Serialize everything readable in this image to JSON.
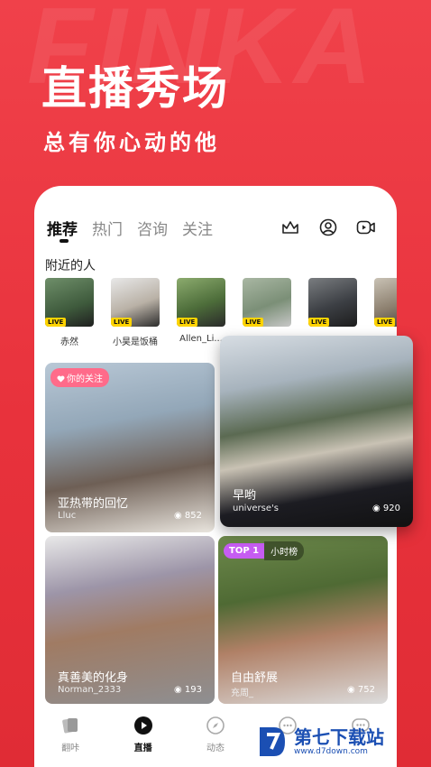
{
  "hero": {
    "bg_logo": "FINKA",
    "title": "直播秀场",
    "subtitle": "总有你心动的他"
  },
  "tabs": [
    {
      "label": "推荐",
      "active": true
    },
    {
      "label": "热门",
      "active": false
    },
    {
      "label": "咨询",
      "active": false
    },
    {
      "label": "关注",
      "active": false
    }
  ],
  "top_icons": [
    "crown-icon",
    "profile-circle-icon",
    "live-camera-icon"
  ],
  "nearby": {
    "label": "附近的人",
    "live_badge": "LIVE",
    "people": [
      {
        "name": "赤然"
      },
      {
        "name": "小昊是饭桶"
      },
      {
        "name": "Allen_Li..."
      },
      {
        "name": ""
      },
      {
        "name": ""
      },
      {
        "name": ""
      }
    ]
  },
  "cards": [
    {
      "title": "亚热带的回忆",
      "user": "Lluc",
      "views": "852",
      "badge": "你的关注"
    },
    {
      "title": "早哟",
      "user": "universe's",
      "views": "920"
    },
    {
      "title": "真善美的化身",
      "user": "Norman_2333",
      "views": "193"
    },
    {
      "title": "自由舒展",
      "user": "充周_",
      "views": "752",
      "badge_top": "TOP 1",
      "badge_rank": "小时榜"
    }
  ],
  "bottom_nav": [
    {
      "label": "翻咔",
      "icon": "cards-icon",
      "active": false
    },
    {
      "label": "直播",
      "icon": "play-icon",
      "active": true
    },
    {
      "label": "动态",
      "icon": "compass-icon",
      "active": false
    },
    {
      "label": "",
      "icon": "chat-icon",
      "active": false
    },
    {
      "label": "",
      "icon": "message-icon",
      "active": false
    }
  ],
  "watermark": {
    "text": "第七下载站",
    "url": "www.d7down.com"
  },
  "colors": {
    "brand_red": "#e8323c",
    "live_yellow": "#ffd400",
    "follow_pink": "#ff6b8a",
    "top_purple": "#c65cf2"
  }
}
